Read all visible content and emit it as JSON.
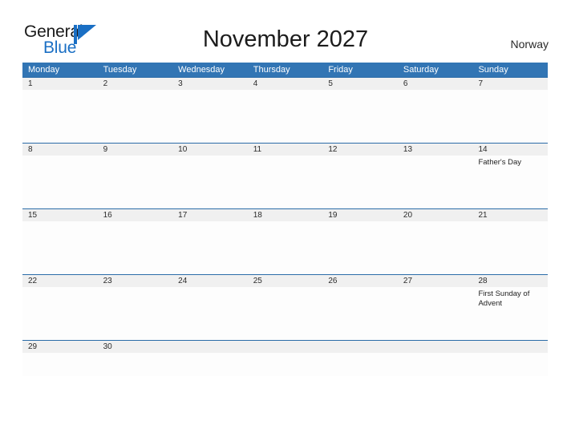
{
  "header": {
    "logo": {
      "text_primary": "General",
      "text_secondary": "Blue",
      "icon": "flag-triangle-icon",
      "color_primary": "#1a1a1a",
      "color_secondary": "#1a6fc4"
    },
    "title": "November 2027",
    "country": "Norway"
  },
  "calendar": {
    "accent_color": "#3275b4",
    "band_color": "#f0f0f0",
    "weekdays": [
      "Monday",
      "Tuesday",
      "Wednesday",
      "Thursday",
      "Friday",
      "Saturday",
      "Sunday"
    ],
    "weeks": [
      {
        "dates": [
          "1",
          "2",
          "3",
          "4",
          "5",
          "6",
          "7"
        ],
        "events": [
          "",
          "",
          "",
          "",
          "",
          "",
          ""
        ]
      },
      {
        "dates": [
          "8",
          "9",
          "10",
          "11",
          "12",
          "13",
          "14"
        ],
        "events": [
          "",
          "",
          "",
          "",
          "",
          "",
          "Father's Day"
        ]
      },
      {
        "dates": [
          "15",
          "16",
          "17",
          "18",
          "19",
          "20",
          "21"
        ],
        "events": [
          "",
          "",
          "",
          "",
          "",
          "",
          ""
        ]
      },
      {
        "dates": [
          "22",
          "23",
          "24",
          "25",
          "26",
          "27",
          "28"
        ],
        "events": [
          "",
          "",
          "",
          "",
          "",
          "",
          "First Sunday of Advent"
        ]
      },
      {
        "dates": [
          "29",
          "30",
          "",
          "",
          "",
          "",
          ""
        ],
        "events": [
          "",
          "",
          "",
          "",
          "",
          "",
          ""
        ]
      }
    ]
  }
}
